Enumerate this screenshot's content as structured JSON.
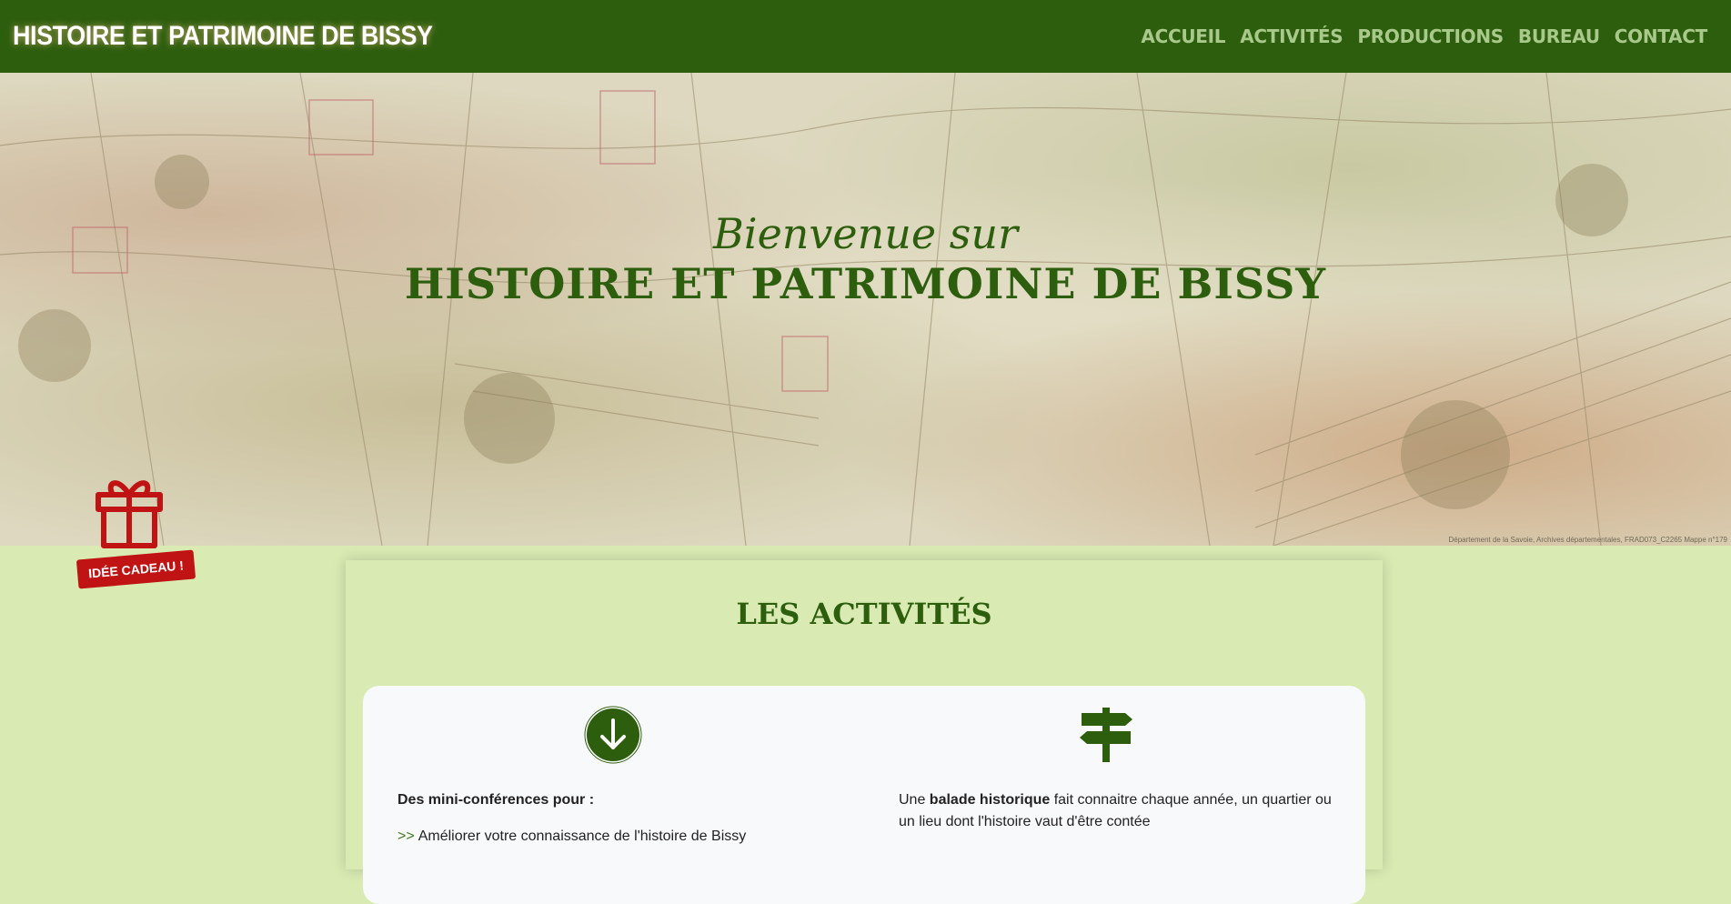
{
  "header": {
    "brand": "HISTOIRE ET PATRIMOINE DE BISSY",
    "nav": [
      "ACCUEIL",
      "ACTIVITÉS",
      "PRODUCTIONS",
      "BUREAU",
      "CONTACT"
    ]
  },
  "hero": {
    "subtitle": "Bienvenue sur",
    "title": "HISTOIRE ET PATRIMOINE DE BISSY",
    "credit": "Département de la Savoie, Archives départementales, FRAD073_C2265 Mappe n°179"
  },
  "gift": {
    "icon": "gift-icon",
    "label": "IDÉE CADEAU !"
  },
  "activities": {
    "title": "LES ACTIVITÉS",
    "left": {
      "icon": "arrow-down-circle-icon",
      "heading": "Des mini-conférences pour :",
      "bullet_prefix": ">>",
      "bullet": "Améliorer votre connaissance de l'histoire de Bissy"
    },
    "right": {
      "icon": "signpost-icon",
      "text_before": "Une ",
      "text_strong": "balade historique",
      "text_after": " fait connaitre chaque année, un quartier ou un lieu dont l'histoire vaut d'être contée"
    }
  },
  "colors": {
    "brand_green": "#2d5e0e",
    "nav_text": "#a9c98b",
    "background": "#d9ebb3",
    "gift_red": "#c01414"
  }
}
